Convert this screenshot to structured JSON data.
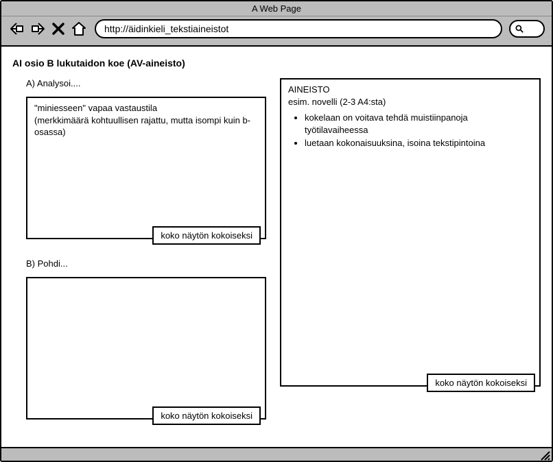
{
  "browser": {
    "title": "A Web Page",
    "url": "http://äidinkieli_tekstiaineistot"
  },
  "page": {
    "title": "AI osio B lukutaidon koe (AV-aineisto)",
    "fullscreen_label": "koko näytön kokoiseksi",
    "sectionA": {
      "label": "A) Analysoi....",
      "line1": "\"miniesseen\" vapaa vastaustila",
      "line2": "(merkkimäärä kohtuullisen rajattu, mutta isompi kuin b-osassa)"
    },
    "sectionB": {
      "label": "B) Pohdi..."
    },
    "material": {
      "heading": "AINEISTO",
      "subheading": "esim. novelli (2-3 A4:sta)",
      "bullets": [
        "kokelaan on voitava tehdä muistiinpanoja työtilavaiheessa",
        "luetaan kokonaisuuksina, isoina tekstipintoina"
      ]
    }
  }
}
